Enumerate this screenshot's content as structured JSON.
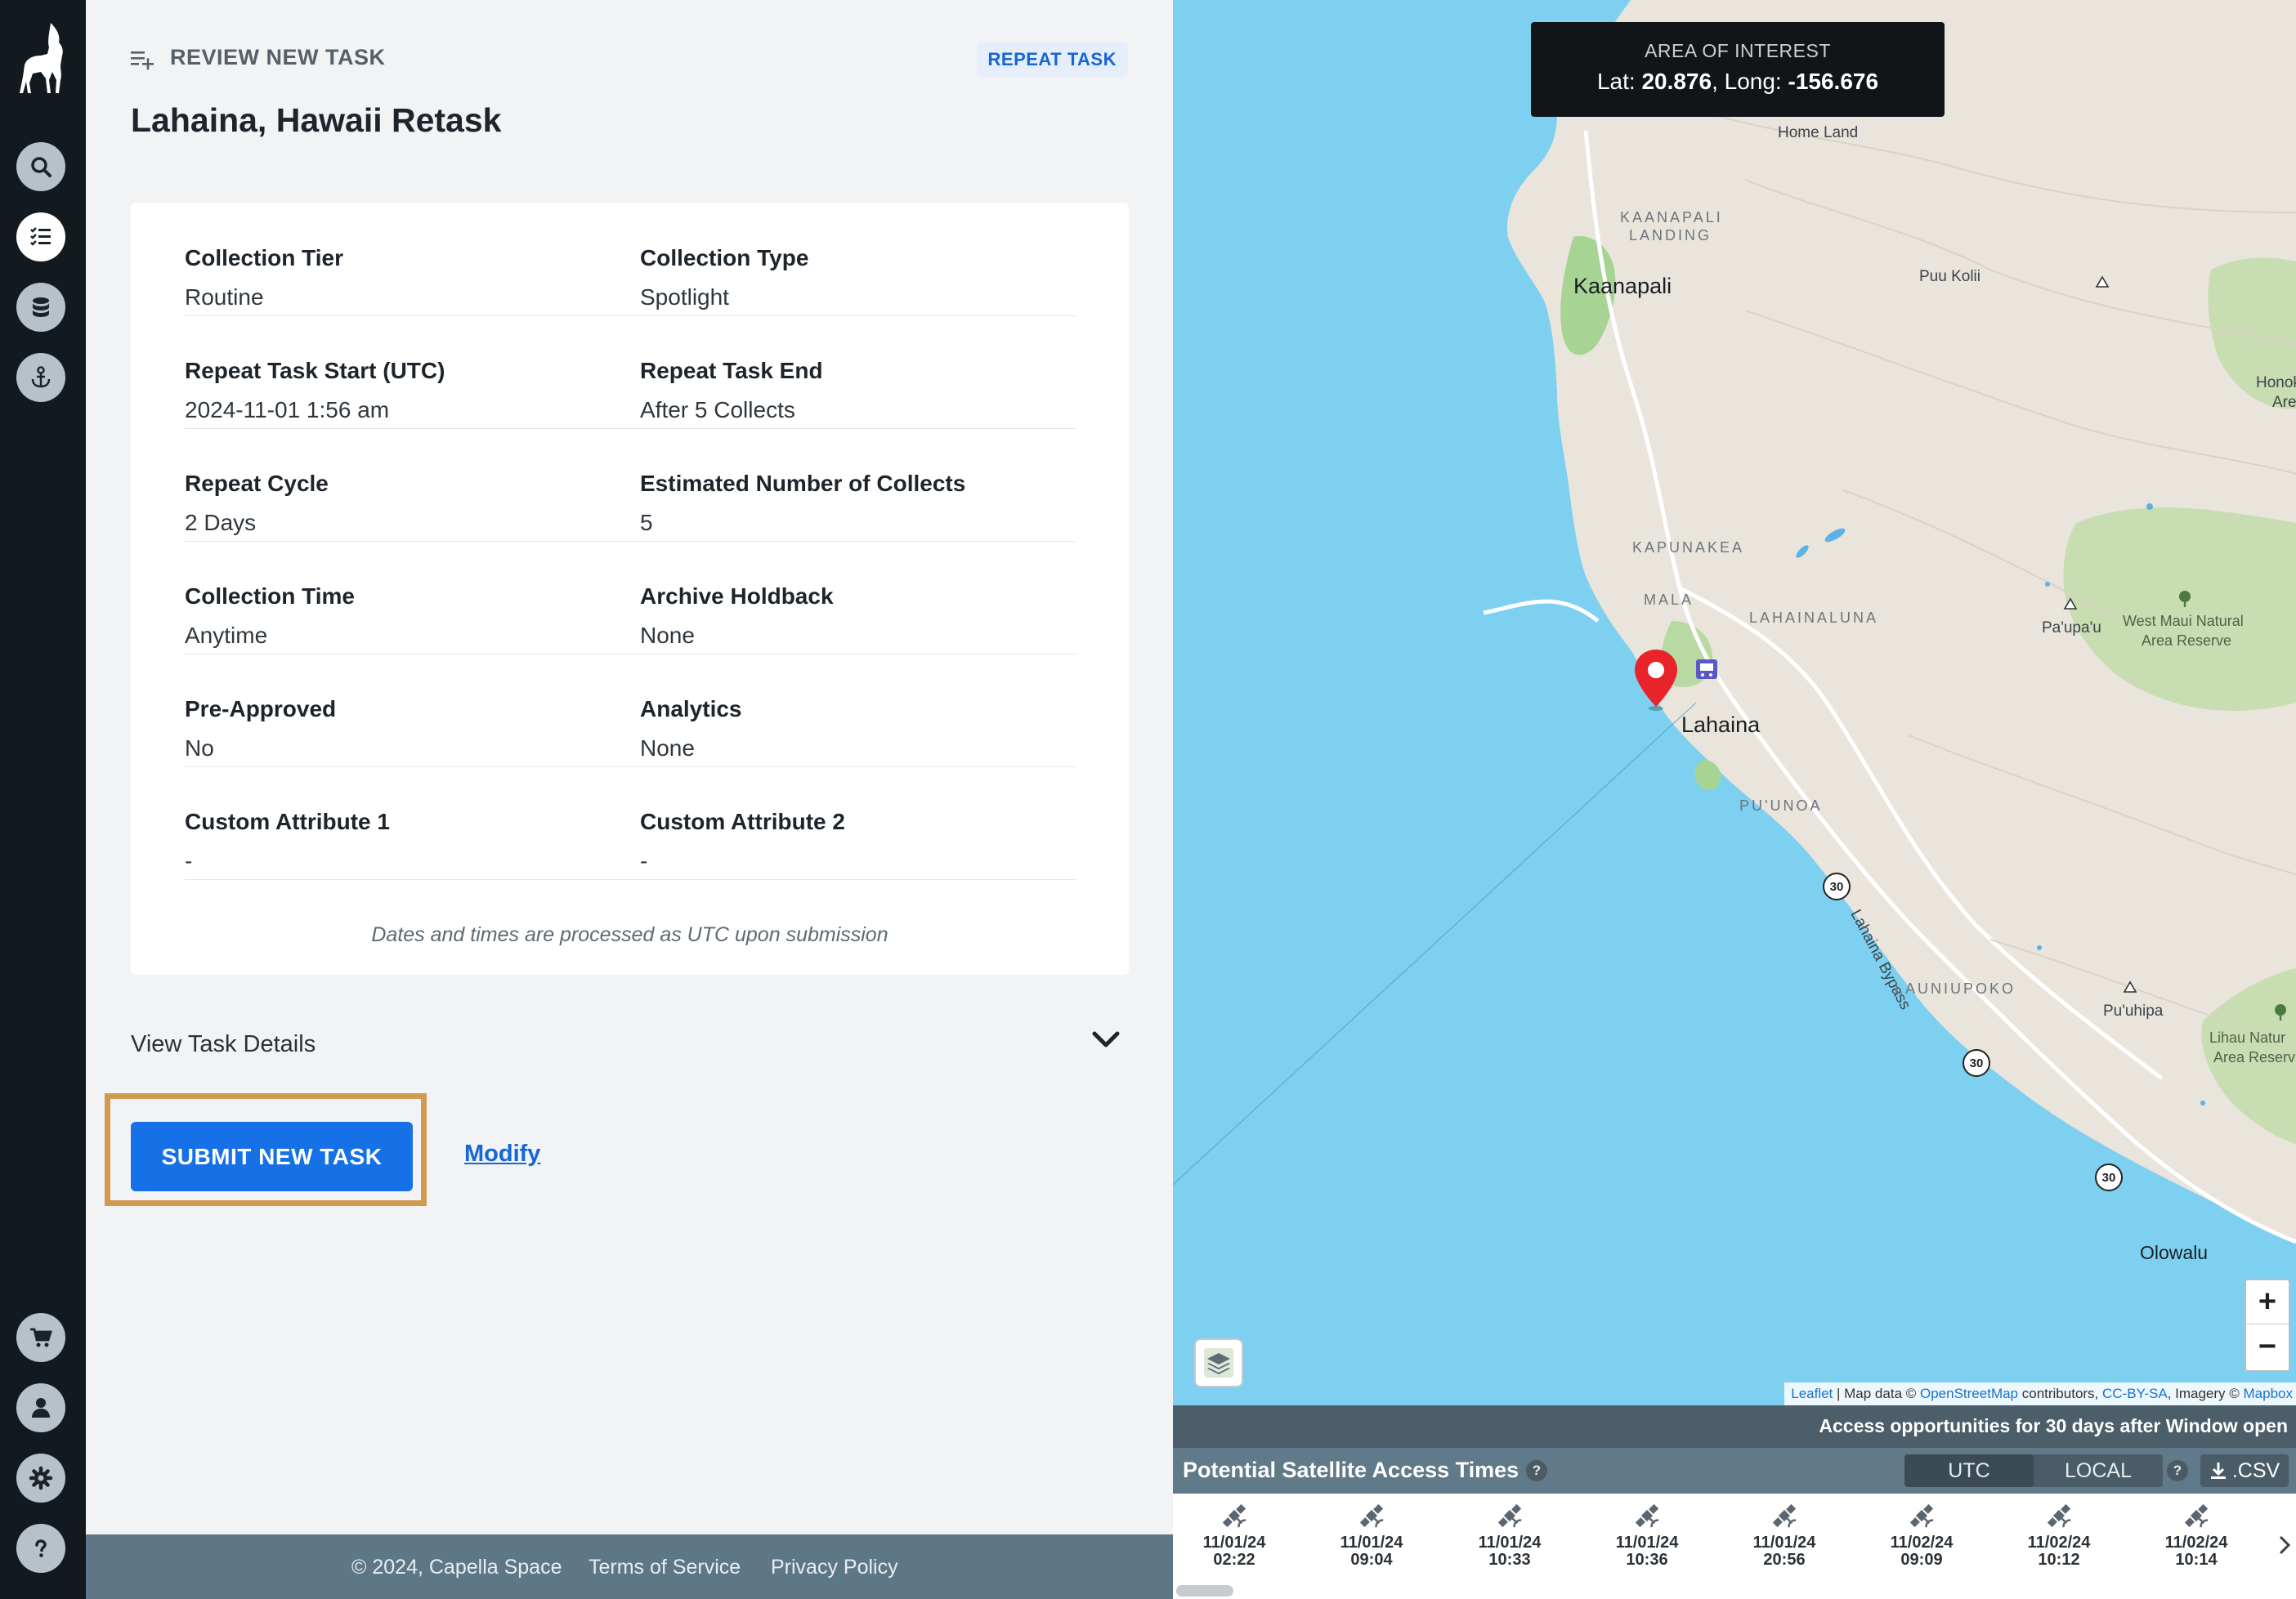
{
  "sidebar": {
    "icons": [
      "logo-icon",
      "search-icon",
      "tasks-icon",
      "database-icon",
      "anchor-icon",
      "cart-icon",
      "user-icon",
      "gear-icon",
      "help-icon"
    ]
  },
  "header": {
    "section_label": "REVIEW NEW TASK",
    "badge": "REPEAT TASK",
    "title": "Lahaina, Hawaii Retask"
  },
  "details": {
    "rows": [
      {
        "left_label": "Collection Tier",
        "left_value": "Routine",
        "right_label": "Collection Type",
        "right_value": "Spotlight"
      },
      {
        "left_label": "Repeat Task Start (UTC)",
        "left_value": "2024-11-01 1:56 am",
        "right_label": "Repeat Task End",
        "right_value": "After 5 Collects"
      },
      {
        "left_label": "Repeat Cycle",
        "left_value": "2 Days",
        "right_label": "Estimated Number of Collects",
        "right_value": "5"
      },
      {
        "left_label": "Collection Time",
        "left_value": "Anytime",
        "right_label": "Archive Holdback",
        "right_value": "None"
      },
      {
        "left_label": "Pre-Approved",
        "left_value": "No",
        "right_label": "Analytics",
        "right_value": "None"
      },
      {
        "left_label": "Custom Attribute 1",
        "left_value": "-",
        "right_label": "Custom Attribute 2",
        "right_value": "-"
      }
    ],
    "note": "Dates and times are processed as UTC upon submission"
  },
  "view_details_label": "View Task Details",
  "actions": {
    "submit_label": "SUBMIT NEW TASK",
    "modify_label": "Modify"
  },
  "footer": {
    "copyright": "© 2024, Capella Space",
    "terms": "Terms of Service",
    "privacy": "Privacy Policy"
  },
  "map": {
    "aoi_title": "AREA OF INTEREST",
    "lat_label": "Lat:",
    "lat_value": "20.876",
    "long_label": ", Long:",
    "long_value": "-156.676",
    "labels": {
      "home_land": "Home Land",
      "kaanapali_landing_1": "KAANAPALI",
      "kaanapali_landing_2": "LANDING",
      "kaanapali": "Kaanapali",
      "puu_kolii": "Puu Kolii",
      "honok_1": "Honok",
      "honok_2": "Are",
      "kapunakea": "KAPUNAKEA",
      "mala": "MALA",
      "lahainaluna": "LAHAINALUNA",
      "paupau": "Pa'upa'u",
      "west_maui_1": "West Maui Natural",
      "west_maui_2": "Area Reserve",
      "lahaina": "Lahaina",
      "puunoa": "PU'UNOA",
      "bypass": "Lahaina Bypass",
      "launiupoko": "LAUNIUPOKO",
      "puuhipa": "Pu'uhipa",
      "lihau_1": "Lihau Natur",
      "lihau_2": "Area Reserv",
      "olowalu": "Olowalu",
      "route_30": "30"
    },
    "zoom_in": "+",
    "zoom_out": "−",
    "attribution": {
      "leaflet": "Leaflet",
      "sep1": " | Map data © ",
      "osm": "OpenStreetMap",
      "contrib": " contributors, ",
      "ccbysa": "CC-BY-SA",
      "imagery": ", Imagery © ",
      "mapbox": "Mapbox"
    }
  },
  "access": {
    "banner": "Access opportunities for 30 days after Window open",
    "title": "Potential Satellite Access Times",
    "help": "?",
    "tz_utc": "UTC",
    "tz_local": "LOCAL",
    "csv_label": ".CSV",
    "slots": [
      {
        "date": "11/01/24",
        "time": "02:22"
      },
      {
        "date": "11/01/24",
        "time": "09:04"
      },
      {
        "date": "11/01/24",
        "time": "10:33"
      },
      {
        "date": "11/01/24",
        "time": "10:36"
      },
      {
        "date": "11/01/24",
        "time": "20:56"
      },
      {
        "date": "11/02/24",
        "time": "09:09"
      },
      {
        "date": "11/02/24",
        "time": "10:12"
      },
      {
        "date": "11/02/24",
        "time": "10:14"
      }
    ]
  },
  "colors": {
    "sidebar_bg": "#131a1f",
    "primary": "#1671e6",
    "highlight_border": "#d19a52",
    "ocean": "#7ed0f0",
    "pin": "#e8232a"
  }
}
